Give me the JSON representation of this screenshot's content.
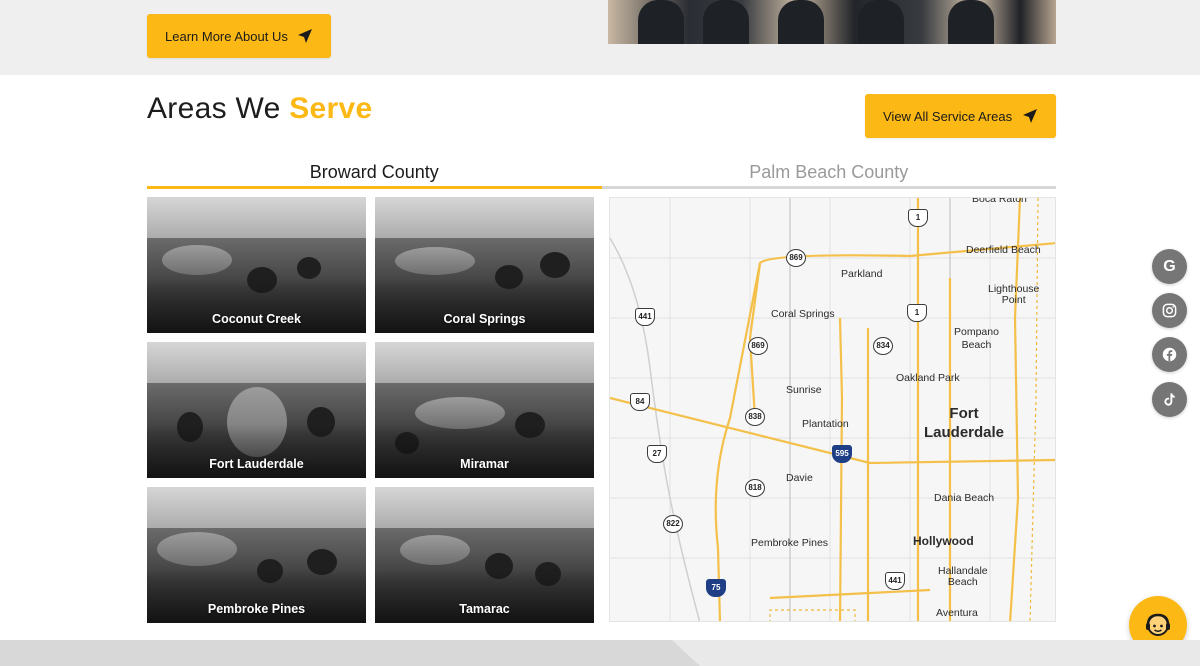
{
  "header": {
    "learn_more_label": "Learn More About Us"
  },
  "areas": {
    "title_plain": "Areas We ",
    "title_accent": "Serve",
    "view_all_label": "View All Service Areas"
  },
  "tabs": [
    {
      "label": "Broward County",
      "active": true
    },
    {
      "label": "Palm Beach County",
      "active": false
    }
  ],
  "cities": [
    {
      "name": "Coconut Creek"
    },
    {
      "name": "Coral Springs"
    },
    {
      "name": "Fort Lauderdale"
    },
    {
      "name": "Miramar"
    },
    {
      "name": "Pembroke Pines"
    },
    {
      "name": "Tamarac"
    }
  ],
  "map": {
    "labels": {
      "boca_raton": "Boca Raton",
      "deerfield_beach": "Deerfield Beach",
      "parkland": "Parkland",
      "lighthouse_point": "Lighthouse\nPoint",
      "coral_springs": "Coral Springs",
      "pompano_beach": "Pompano\nBeach",
      "oakland_park": "Oakland Park",
      "sunrise": "Sunrise",
      "fort_lauderdale": "Fort\nLauderdale",
      "plantation": "Plantation",
      "davie": "Davie",
      "dania_beach": "Dania Beach",
      "pembroke_pines": "Pembroke Pines",
      "hollywood": "Hollywood",
      "hallandale_beach": "Hallandale\nBeach",
      "aventura": "Aventura"
    },
    "shields": {
      "s1a": "1",
      "s869a": "869",
      "s441a": "441",
      "s1b": "1",
      "s869b": "869",
      "s834": "834",
      "s84": "84",
      "s838": "838",
      "s595": "595",
      "s27": "27",
      "s818": "818",
      "s822": "822",
      "s441b": "441",
      "s75": "75"
    }
  },
  "social": {
    "google_letter": "G"
  },
  "colors": {
    "accent": "#fcb814",
    "social_bg": "#767676"
  }
}
